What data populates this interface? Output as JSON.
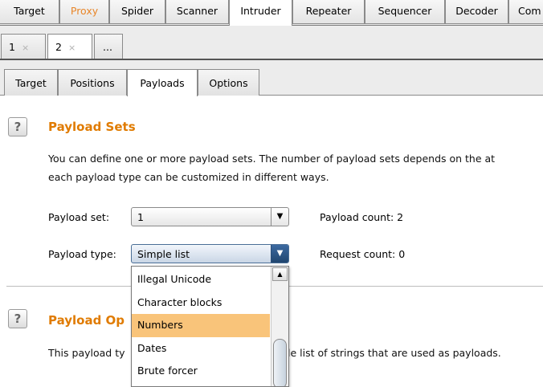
{
  "top_tabs": [
    {
      "label": "Target"
    },
    {
      "label": "Proxy"
    },
    {
      "label": "Spider"
    },
    {
      "label": "Scanner"
    },
    {
      "label": "Intruder"
    },
    {
      "label": "Repeater"
    },
    {
      "label": "Sequencer"
    },
    {
      "label": "Decoder"
    },
    {
      "label": "Com"
    }
  ],
  "instance_tabs": {
    "tab1": "1",
    "tab2": "2",
    "more": "...",
    "close_glyph": "×"
  },
  "sub_tabs": [
    {
      "label": "Target"
    },
    {
      "label": "Positions"
    },
    {
      "label": "Payloads"
    },
    {
      "label": "Options"
    }
  ],
  "help_glyph": "?",
  "payload_sets": {
    "title": "Payload Sets",
    "description_line1": "You can define one or more payload sets. The number of payload sets depends on the at",
    "description_line2": "each payload type can be customized in different ways.",
    "set_label": "Payload set:",
    "set_value": "1",
    "type_label": "Payload type:",
    "type_value": "Simple list",
    "payload_count": "Payload count:  2",
    "request_count": "Request count:  0"
  },
  "payload_options": {
    "title": "Payload Op",
    "description_start": "This payload ty",
    "description_end": "le list of strings that are used as payloads."
  },
  "dropdown": {
    "items": [
      "Illegal Unicode",
      "Character blocks",
      "Numbers",
      "Dates",
      "Brute forcer"
    ],
    "selected": "Numbers"
  },
  "colors": {
    "accent_orange": "#e07b00",
    "selected_item": "#f9c47a",
    "focused_arrow": "#2b5585"
  }
}
